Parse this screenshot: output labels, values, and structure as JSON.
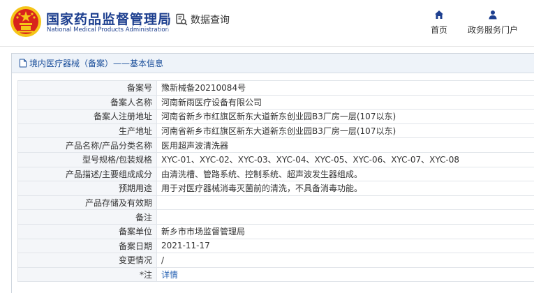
{
  "header": {
    "title_cn": "国家药品监督管理局",
    "title_en": "National Medical Products Administration",
    "query_label": "数据查询",
    "nav": [
      {
        "label": "首页",
        "icon": "home-icon"
      },
      {
        "label": "政务服务门户",
        "icon": "user-icon"
      }
    ]
  },
  "panel": {
    "title": "境内医疗器械（备案）——基本信息"
  },
  "rows": [
    {
      "label": "备案号",
      "value": "豫新械备20210084号"
    },
    {
      "label": "备案人名称",
      "value": "河南新雨医疗设备有限公司"
    },
    {
      "label": "备案人注册地址",
      "value": "河南省新乡市红旗区新东大道新东创业园B3厂房一层(107以东)"
    },
    {
      "label": "生产地址",
      "value": "河南省新乡市红旗区新东大道新东创业园B3厂房一层(107以东)"
    },
    {
      "label": "产品名称/产品分类名称",
      "value": "医用超声波清洗器"
    },
    {
      "label": "型号规格/包装规格",
      "value": "XYC-01、XYC-02、XYC-03、XYC-04、XYC-05、XYC-06、XYC-07、XYC-08"
    },
    {
      "label": "产品描述/主要组成成分",
      "value": "由清洗槽、管路系统、控制系统、超声波发生器组成。"
    },
    {
      "label": "预期用途",
      "value": "用于对医疗器械消毒灭菌前的清洗，不具备消毒功能。"
    },
    {
      "label": "产品存储及有效期",
      "value": ""
    },
    {
      "label": "备注",
      "value": ""
    },
    {
      "label": "备案单位",
      "value": "新乡市市场监督管理局"
    },
    {
      "label": "备案日期",
      "value": "2021-11-17"
    },
    {
      "label": "变更情况",
      "value": "/"
    }
  ],
  "note_row": {
    "star": "*",
    "label": "注",
    "link_text": "详情"
  },
  "colors": {
    "brand": "#1d3f8f",
    "link": "#2a64b4",
    "header_bg": "#eef3f9",
    "label_bg": "#f4f6f9",
    "emblem_red": "#d8231c",
    "emblem_gold": "#f5c518"
  }
}
